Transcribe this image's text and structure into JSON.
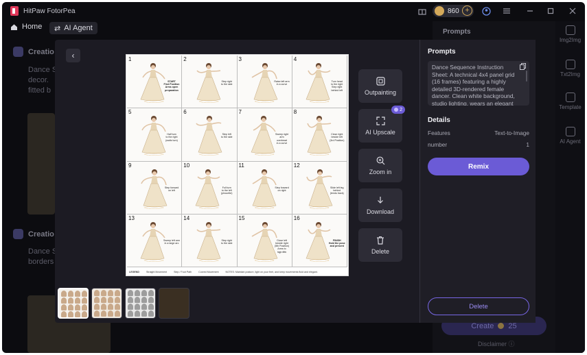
{
  "app": {
    "title": "HitPaw FotorPea",
    "credits": "860"
  },
  "nav": {
    "home_label": "Home",
    "agent_label": "AI Agent"
  },
  "background": {
    "section1_title": "Creatio",
    "section1_text": [
      "Dance S",
      "decor.",
      "fitted b"
    ],
    "section2_title": "Creatio",
    "section2_text": [
      "Dance S",
      "borders"
    ],
    "right_panel_title": "Prompts",
    "create_label": "Create",
    "create_cost": "25",
    "disclaimer": "Disclaimer"
  },
  "sidebar": {
    "items": [
      {
        "label": "Img2Img",
        "icon": "image-icon"
      },
      {
        "label": "Txt2Img",
        "icon": "text-image-icon"
      },
      {
        "label": "Template",
        "icon": "template-icon"
      },
      {
        "label": "AI Agent",
        "icon": "agent-icon"
      }
    ]
  },
  "modal": {
    "image": {
      "cells": [
        {
          "num": "1",
          "note": "START\nFirst Position\nArms open\npreparation"
        },
        {
          "num": "2",
          "note": "Step right\nto the side"
        },
        {
          "num": "3",
          "note": "Raise left arm\nin a curve"
        },
        {
          "num": "4",
          "note": "Turn head\nto the right\nStep right\nbehind left"
        },
        {
          "num": "5",
          "note": "Half turn\nto the right\n(waltz turn)"
        },
        {
          "num": "6",
          "note": "Step left\nto the side"
        },
        {
          "num": "7",
          "note": "Sweep right arm\noverhead\nin a curve"
        },
        {
          "num": "8",
          "note": "Close right\nbeside left\n(3rd Position)"
        },
        {
          "num": "9",
          "note": "Step forward\non left"
        },
        {
          "num": "10",
          "note": "Full turn\nto the left\n(pirouette)"
        },
        {
          "num": "11",
          "note": "Step forward\non right"
        },
        {
          "num": "12",
          "note": "Slide left leg\nbehind\n(tendu back)"
        },
        {
          "num": "13",
          "note": "Sweep left arm\nin a large arc"
        },
        {
          "num": "14",
          "note": "Step right\nto the side"
        },
        {
          "num": "15",
          "note": "Close left\nbeside right\n(5th Position)\nArms to\nhigh fifth"
        },
        {
          "num": "16",
          "note": "FINISH\nHold the pose\nand present"
        }
      ],
      "legend": {
        "title": "LEGEND",
        "items": [
          "Straight Movement",
          "Step / Foot Path",
          "Curved Movement"
        ],
        "notes": "NOTES: Maintain posture, light on your feet, and keep movements fluid and elegant."
      }
    },
    "tools": [
      {
        "label": "Outpainting",
        "icon": "outpainting-icon"
      },
      {
        "label": "AI Upscale",
        "icon": "upscale-icon",
        "badge": "2"
      },
      {
        "label": "Zoom in",
        "icon": "zoom-in-icon"
      },
      {
        "label": "Download",
        "icon": "download-icon"
      },
      {
        "label": "Delete",
        "icon": "trash-icon"
      }
    ],
    "panel": {
      "prompts_title": "Prompts",
      "prompt_text": "Dance Sequence Instruction Sheet: A technical 4x4 panel grid (16 frames) featuring a highly detailed 3D-rendered female dancer. Clean white background, studio lighting, wears an elegant European",
      "details_title": "Details",
      "features_label": "Features",
      "features_value": "Text-to-Image",
      "number_label": "number",
      "number_value": "1",
      "remix_label": "Remix",
      "delete_label": "Delete"
    }
  },
  "colors": {
    "accent": "#6b5bd6",
    "background": "#0c0c10",
    "modal": "#1c1b23",
    "gold": "#d4a95a"
  }
}
